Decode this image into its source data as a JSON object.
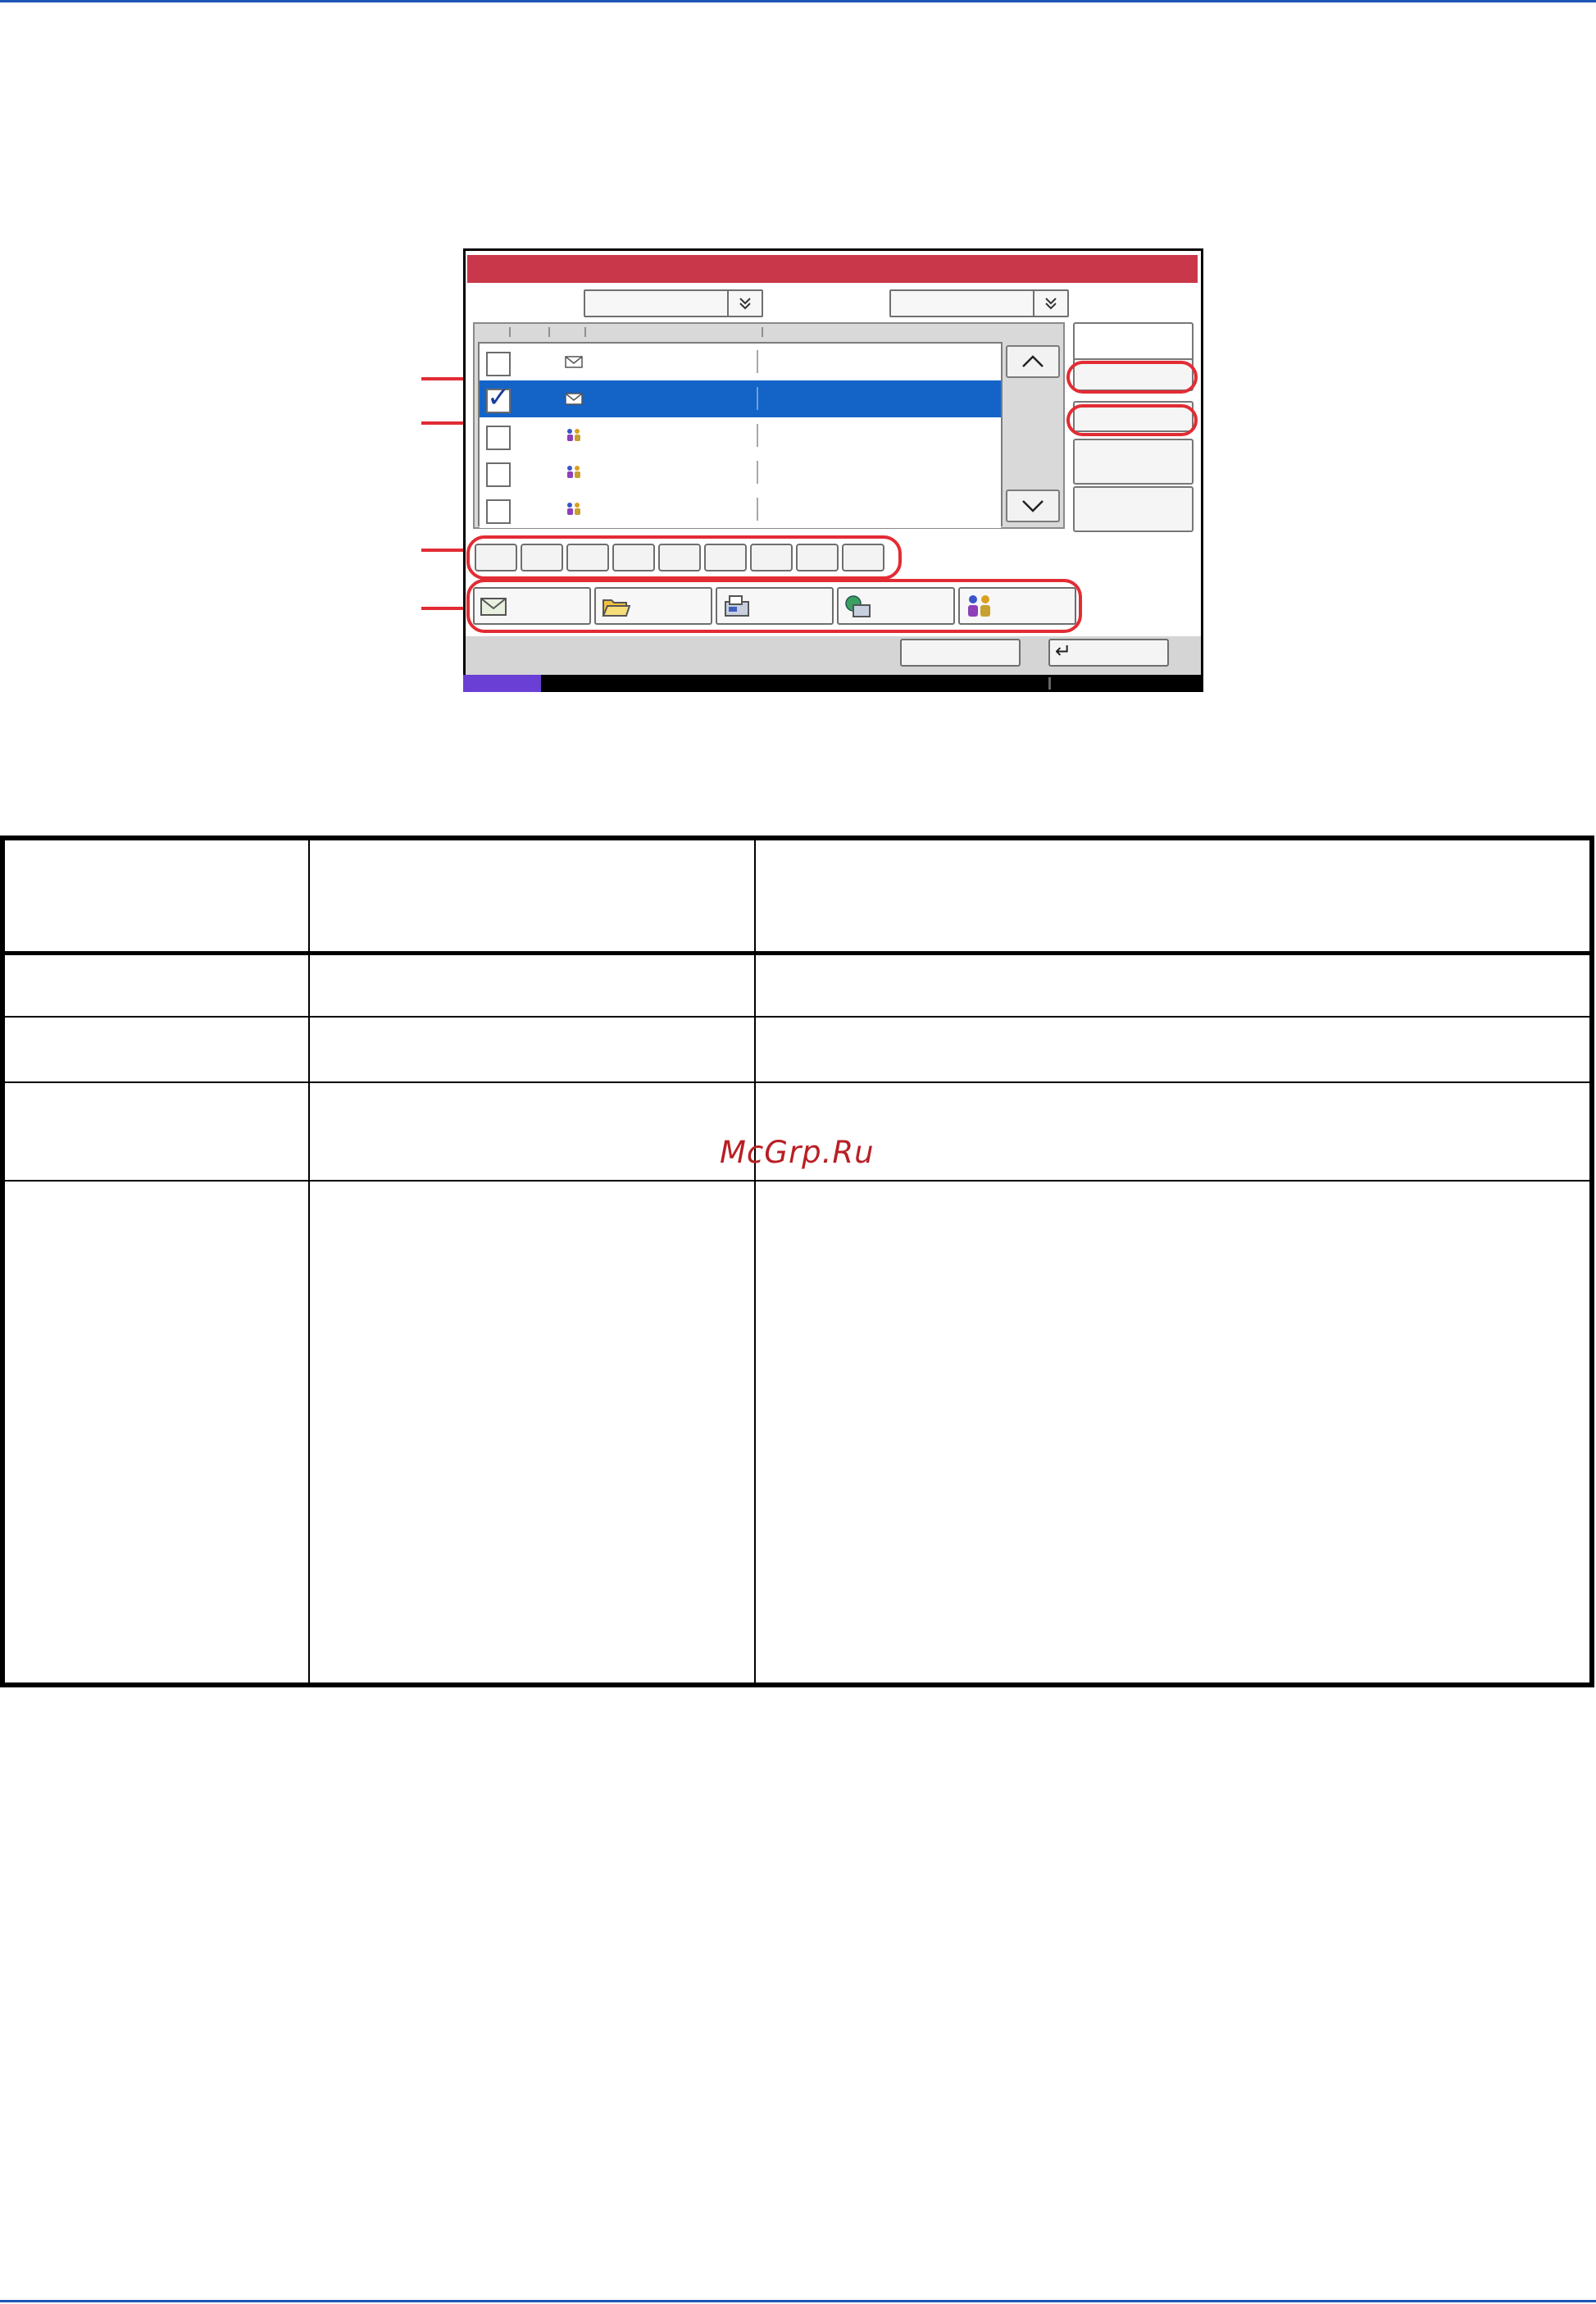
{
  "page": {
    "top_rule_color": "#1f56b5",
    "bottom_rule_color": "#1f56b5"
  },
  "screen": {
    "title_bar_color": "#c9384a",
    "selection_color": "#1464c8",
    "status_accent_color": "#6a3fd6",
    "scroll_up_icon": "chevron-up-icon",
    "scroll_down_icon": "chevron-down-icon",
    "dropdown_icon": "double-chevron-down-icon",
    "list_rows": [
      {
        "selected": false,
        "icon": "email-icon"
      },
      {
        "selected": true,
        "icon": "email-icon"
      },
      {
        "selected": false,
        "icon": "group-icon"
      },
      {
        "selected": false,
        "icon": "group-icon"
      },
      {
        "selected": false,
        "icon": "group-icon"
      }
    ],
    "letter_key_count": 9,
    "category_buttons": [
      {
        "icon": "email-icon"
      },
      {
        "icon": "folder-icon"
      },
      {
        "icon": "fax-icon"
      },
      {
        "icon": "i-fax-icon"
      },
      {
        "icon": "group-icon"
      }
    ],
    "enter_glyph": "↵",
    "callout_color": "#e22c34"
  },
  "watermark": {
    "text": "McGrp.Ru",
    "color": "#b81f24"
  }
}
